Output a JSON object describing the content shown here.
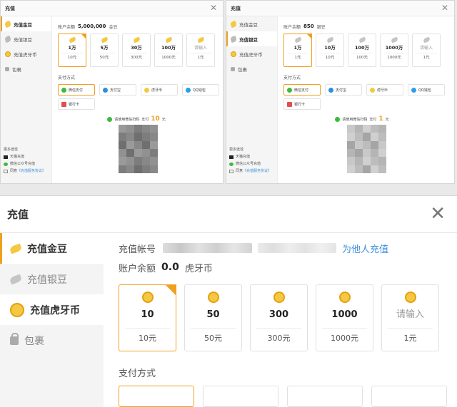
{
  "mini_left": {
    "title": "充值",
    "sidebar": [
      "充值金豆",
      "充值银豆",
      "充值虎牙币",
      "包裹"
    ],
    "more": [
      "更多途径",
      "天猫充值",
      "微信公众号充值"
    ],
    "agree_prefix": "同意",
    "agree_link": "《充值服务协议》",
    "balance_label": "账户余额",
    "balance_value": "5,000,000",
    "balance_unit": "金豆",
    "options": [
      {
        "amount": "1万",
        "price": "10元"
      },
      {
        "amount": "5万",
        "price": "50元"
      },
      {
        "amount": "30万",
        "price": "300元"
      },
      {
        "amount": "100万",
        "price": "1000元"
      },
      {
        "amount": "请输入",
        "price": "1元"
      }
    ],
    "pay_label": "支付方式",
    "pay_methods": [
      "微信支付",
      "支付宝",
      "虎牙币",
      "QQ钱包",
      "银行卡"
    ],
    "qr_prefix": "请使用微信扫码",
    "qr_pay": "支付",
    "qr_amount": "10",
    "qr_unit": "元"
  },
  "mini_right": {
    "title": "充值",
    "sidebar": [
      "充值金豆",
      "充值银豆",
      "充值虎牙币",
      "包裹"
    ],
    "more": [
      "更多途径",
      "天猫充值",
      "微信公众号充值"
    ],
    "agree_prefix": "同意",
    "agree_link": "《充值服务协议》",
    "balance_label": "账户余额",
    "balance_value": "850",
    "balance_unit": "银豆",
    "options": [
      {
        "amount": "1万",
        "price": "1元"
      },
      {
        "amount": "10万",
        "price": "10元"
      },
      {
        "amount": "100万",
        "price": "100元"
      },
      {
        "amount": "1000万",
        "price": "1000元"
      },
      {
        "amount": "请输入",
        "price": "1元"
      }
    ],
    "pay_label": "支付方式",
    "pay_methods": [
      "微信支付",
      "支付宝",
      "虎牙币",
      "QQ钱包",
      "银行卡"
    ],
    "qr_prefix": "请使用微信扫码",
    "qr_pay": "支付",
    "qr_amount": "1",
    "qr_unit": "元"
  },
  "big": {
    "title": "充值",
    "sidebar": [
      "充值金豆",
      "充值银豆",
      "充值虎牙币",
      "包裹"
    ],
    "account_label": "充值帐号",
    "recharge_others": "为他人充值",
    "balance_label": "账户余额",
    "balance_value": "0.0",
    "balance_unit": "虎牙币",
    "options": [
      {
        "amount": "10",
        "price": "10元"
      },
      {
        "amount": "50",
        "price": "50元"
      },
      {
        "amount": "300",
        "price": "300元"
      },
      {
        "amount": "1000",
        "price": "1000元"
      },
      {
        "amount": "请输入",
        "price": "1元"
      }
    ],
    "pay_label": "支付方式"
  },
  "colors": {
    "accent": "#f0a020",
    "link": "#3b8fd9",
    "coin": "#f5c842"
  }
}
